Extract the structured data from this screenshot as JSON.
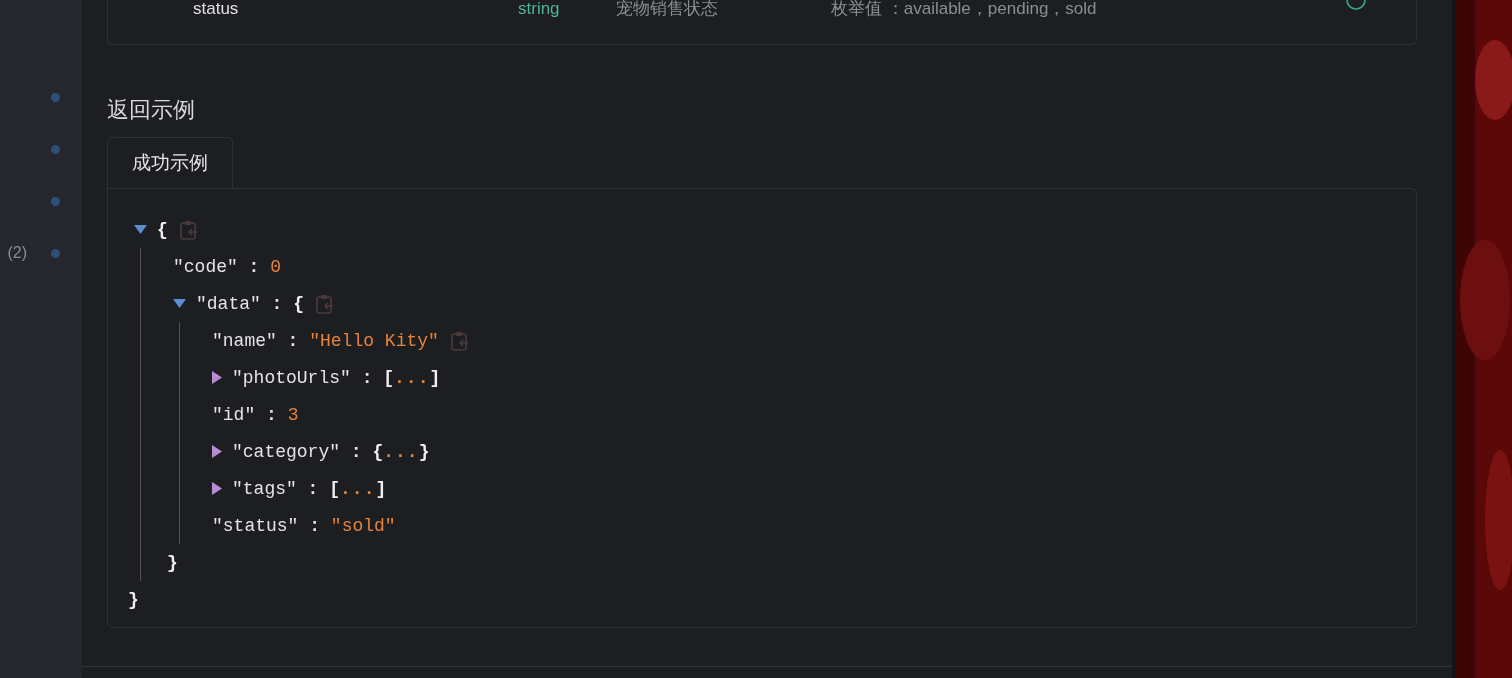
{
  "param_row": {
    "name": "status",
    "type": "string",
    "description": "宠物销售状态",
    "note": "枚举值 ：available，pending，sold",
    "required": true
  },
  "sidebar": {
    "items": [
      {
        "kind": "dot"
      },
      {
        "kind": "dot"
      },
      {
        "kind": "dot"
      },
      {
        "kind": "dot",
        "count": "(2)"
      }
    ]
  },
  "response": {
    "heading": "返回示例",
    "tabs": [
      {
        "label": "成功示例",
        "selected": true
      }
    ],
    "tree": {
      "open": "{",
      "close": "}",
      "kind": "object",
      "expanded": true,
      "copy": true,
      "children": [
        {
          "key": "\"code\"",
          "sep": ":",
          "value": "0",
          "kind": "number"
        },
        {
          "key": "\"data\"",
          "sep": ":",
          "open": "{",
          "close": "}",
          "kind": "object",
          "expanded": true,
          "copy": true,
          "children": [
            {
              "key": "\"name\"",
              "sep": ":",
              "value": "\"Hello Kity\"",
              "kind": "string",
              "copy": true
            },
            {
              "key": "\"photoUrls\"",
              "sep": ":",
              "open": "[",
              "ellipsis": "...",
              "close": "]",
              "kind": "array",
              "expanded": false
            },
            {
              "key": "\"id\"",
              "sep": ":",
              "value": "3",
              "kind": "number"
            },
            {
              "key": "\"category\"",
              "sep": ":",
              "open": "{",
              "ellipsis": "...",
              "close": "}",
              "kind": "object",
              "expanded": false
            },
            {
              "key": "\"tags\"",
              "sep": ":",
              "open": "[",
              "ellipsis": "...",
              "close": "]",
              "kind": "array",
              "expanded": false
            },
            {
              "key": "\"status\"",
              "sep": ":",
              "value": "\"sold\"",
              "kind": "string"
            }
          ]
        }
      ]
    }
  }
}
